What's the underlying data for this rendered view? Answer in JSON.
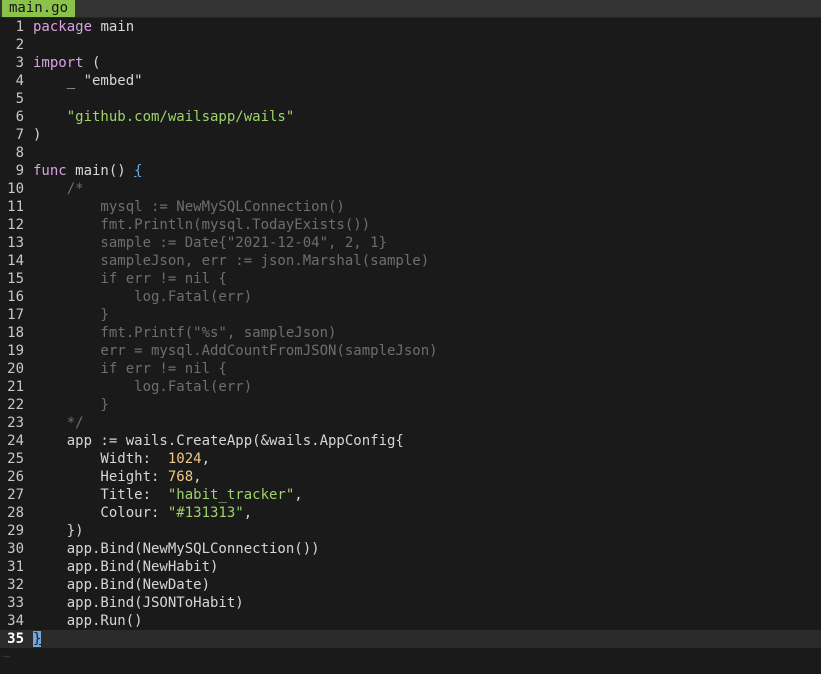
{
  "tab": {
    "label": "main.go"
  },
  "colors": {
    "background": "#1a1a1a",
    "tab_active": "#8bc34a",
    "keyword": "#d6a3e0",
    "string": "#9ed36a",
    "number": "#f2c78a",
    "comment": "#6e6e6e",
    "cursor": "#6fa8dc"
  },
  "editor": {
    "current_line": 35,
    "lines": [
      {
        "n": "1",
        "tokens": [
          {
            "t": "package",
            "k": "keyword"
          },
          {
            "t": " main",
            "k": "plain"
          }
        ]
      },
      {
        "n": "2",
        "tokens": []
      },
      {
        "n": "3",
        "tokens": [
          {
            "t": "import",
            "k": "keyword"
          },
          {
            "t": " (",
            "k": "plain"
          }
        ]
      },
      {
        "n": "4",
        "tokens": [
          {
            "t": "    _ \"embed\"",
            "k": "plain"
          }
        ]
      },
      {
        "n": "5",
        "tokens": []
      },
      {
        "n": "6",
        "tokens": [
          {
            "t": "    ",
            "k": "plain"
          },
          {
            "t": "\"github.com/wailsapp/wails\"",
            "k": "string"
          }
        ]
      },
      {
        "n": "7",
        "tokens": [
          {
            "t": ")",
            "k": "plain"
          }
        ]
      },
      {
        "n": "8",
        "tokens": []
      },
      {
        "n": "9",
        "tokens": [
          {
            "t": "func",
            "k": "keyword"
          },
          {
            "t": " main() ",
            "k": "plain"
          },
          {
            "t": "{",
            "k": "brace-match"
          }
        ]
      },
      {
        "n": "10",
        "tokens": [
          {
            "t": "    /*",
            "k": "comment"
          }
        ]
      },
      {
        "n": "11",
        "tokens": [
          {
            "t": "        mysql := NewMySQLConnection()",
            "k": "comment"
          }
        ]
      },
      {
        "n": "12",
        "tokens": [
          {
            "t": "        fmt.Println(mysql.TodayExists())",
            "k": "comment"
          }
        ]
      },
      {
        "n": "13",
        "tokens": [
          {
            "t": "        sample := Date{\"2021-12-04\", 2, 1}",
            "k": "comment"
          }
        ]
      },
      {
        "n": "14",
        "tokens": [
          {
            "t": "        sampleJson, err := json.Marshal(sample)",
            "k": "comment"
          }
        ]
      },
      {
        "n": "15",
        "tokens": [
          {
            "t": "        if err != nil {",
            "k": "comment"
          }
        ]
      },
      {
        "n": "16",
        "tokens": [
          {
            "t": "            log.Fatal(err)",
            "k": "comment"
          }
        ]
      },
      {
        "n": "17",
        "tokens": [
          {
            "t": "        }",
            "k": "comment"
          }
        ]
      },
      {
        "n": "18",
        "tokens": [
          {
            "t": "        fmt.Printf(\"%s\", sampleJson)",
            "k": "comment"
          }
        ]
      },
      {
        "n": "19",
        "tokens": [
          {
            "t": "        err = mysql.AddCountFromJSON(sampleJson)",
            "k": "comment"
          }
        ]
      },
      {
        "n": "20",
        "tokens": [
          {
            "t": "        if err != nil {",
            "k": "comment"
          }
        ]
      },
      {
        "n": "21",
        "tokens": [
          {
            "t": "            log.Fatal(err)",
            "k": "comment"
          }
        ]
      },
      {
        "n": "22",
        "tokens": [
          {
            "t": "        }",
            "k": "comment"
          }
        ]
      },
      {
        "n": "23",
        "tokens": [
          {
            "t": "    */",
            "k": "comment"
          }
        ]
      },
      {
        "n": "24",
        "tokens": [
          {
            "t": "    app := wails.CreateApp(&wails.AppConfig{",
            "k": "plain"
          }
        ]
      },
      {
        "n": "25",
        "tokens": [
          {
            "t": "        Width:  ",
            "k": "plain"
          },
          {
            "t": "1024",
            "k": "number"
          },
          {
            "t": ",",
            "k": "plain"
          }
        ]
      },
      {
        "n": "26",
        "tokens": [
          {
            "t": "        Height: ",
            "k": "plain"
          },
          {
            "t": "768",
            "k": "number"
          },
          {
            "t": ",",
            "k": "plain"
          }
        ]
      },
      {
        "n": "27",
        "tokens": [
          {
            "t": "        Title:  ",
            "k": "plain"
          },
          {
            "t": "\"habit_tracker\"",
            "k": "string"
          },
          {
            "t": ",",
            "k": "plain"
          }
        ]
      },
      {
        "n": "28",
        "tokens": [
          {
            "t": "        Colour: ",
            "k": "plain"
          },
          {
            "t": "\"#131313\"",
            "k": "string"
          },
          {
            "t": ",",
            "k": "plain"
          }
        ]
      },
      {
        "n": "29",
        "tokens": [
          {
            "t": "    })",
            "k": "plain"
          }
        ]
      },
      {
        "n": "30",
        "tokens": [
          {
            "t": "    app.Bind(NewMySQLConnection())",
            "k": "plain"
          }
        ]
      },
      {
        "n": "31",
        "tokens": [
          {
            "t": "    app.Bind(NewHabit)",
            "k": "plain"
          }
        ]
      },
      {
        "n": "32",
        "tokens": [
          {
            "t": "    app.Bind(NewDate)",
            "k": "plain"
          }
        ]
      },
      {
        "n": "33",
        "tokens": [
          {
            "t": "    app.Bind(JSONToHabit)",
            "k": "plain"
          }
        ]
      },
      {
        "n": "34",
        "tokens": [
          {
            "t": "    app.Run()",
            "k": "plain"
          }
        ]
      },
      {
        "n": "35",
        "tokens": [
          {
            "t": "}",
            "k": "cursor"
          }
        ]
      }
    ],
    "empty_marker": "~"
  }
}
